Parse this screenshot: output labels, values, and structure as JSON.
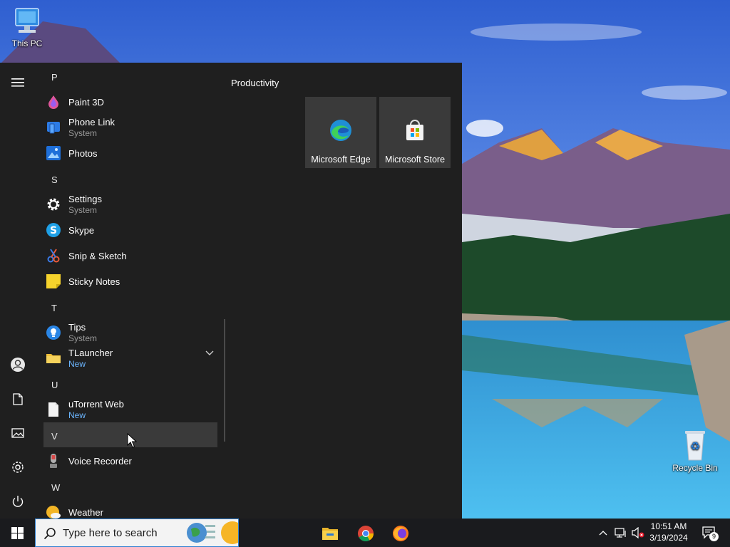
{
  "desktop": {
    "this_pc_label": "This PC",
    "recycle_bin_label": "Recycle Bin"
  },
  "start_menu": {
    "sections": [
      {
        "letter": "P",
        "apps": [
          {
            "name": "Paint 3D",
            "sub": "",
            "icon": "paint-3d-icon"
          },
          {
            "name": "Phone Link",
            "sub": "System",
            "icon": "phone-link-icon"
          },
          {
            "name": "Photos",
            "sub": "",
            "icon": "photos-icon"
          }
        ]
      },
      {
        "letter": "S",
        "apps": [
          {
            "name": "Settings",
            "sub": "System",
            "icon": "gear-icon"
          },
          {
            "name": "Skype",
            "sub": "",
            "icon": "skype-icon"
          },
          {
            "name": "Snip & Sketch",
            "sub": "",
            "icon": "snip-sketch-icon"
          },
          {
            "name": "Sticky Notes",
            "sub": "",
            "icon": "sticky-notes-icon"
          }
        ]
      },
      {
        "letter": "T",
        "apps": [
          {
            "name": "Tips",
            "sub": "System",
            "icon": "tips-icon"
          },
          {
            "name": "TLauncher",
            "sub": "New",
            "icon": "folder-icon"
          }
        ]
      },
      {
        "letter": "U",
        "apps": [
          {
            "name": "uTorrent Web",
            "sub": "New",
            "icon": "file-icon"
          }
        ]
      },
      {
        "letter": "V",
        "apps": [
          {
            "name": "Voice Recorder",
            "sub": "",
            "icon": "microphone-icon"
          }
        ]
      },
      {
        "letter": "W",
        "apps": [
          {
            "name": "Weather",
            "sub": "",
            "icon": "weather-icon"
          }
        ]
      }
    ],
    "tile_group_name": "Productivity",
    "tiles": [
      {
        "label": "Microsoft Edge",
        "icon": "edge-icon"
      },
      {
        "label": "Microsoft Store",
        "icon": "store-icon"
      }
    ]
  },
  "taskbar": {
    "search_placeholder": "Type here to search",
    "apps": [
      "file-explorer-icon",
      "chrome-icon",
      "firefox-icon"
    ],
    "clock_time": "10:51 AM",
    "clock_date": "3/19/2024",
    "notification_count": "9"
  }
}
